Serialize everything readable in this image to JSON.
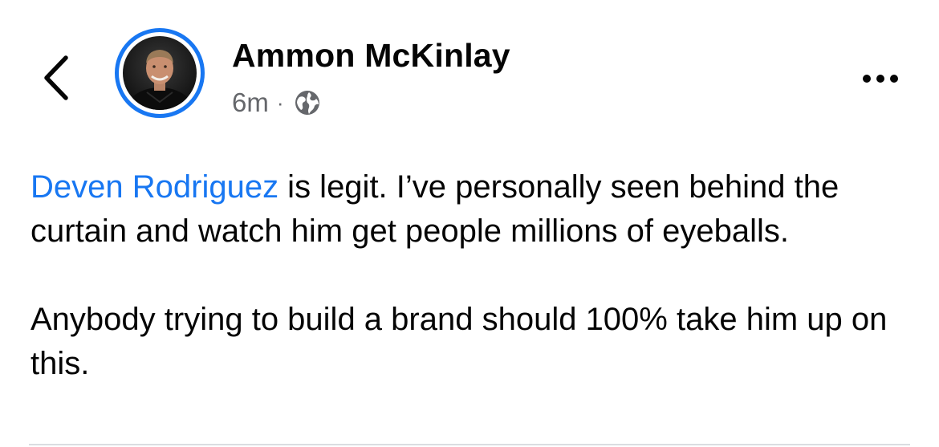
{
  "post": {
    "author": {
      "name": "Ammon McKinlay",
      "avatar_icon": "profile-photo"
    },
    "meta": {
      "time": "6m",
      "separator": "·",
      "audience_icon": "globe-icon"
    },
    "body": {
      "mention": "Deven Rodriguez",
      "paragraph1_rest": " is legit. I’ve personally seen behind the curtain and watch him get people millions of eyeballs.",
      "paragraph2": "Anybody trying to build a brand should 100% take him up on this."
    }
  },
  "icons": {
    "back": "chevron-left-icon",
    "more": "more-horizontal-icon"
  },
  "colors": {
    "accent": "#1877f2",
    "text": "#050505",
    "secondary_text": "#65676b",
    "divider": "#dadde1"
  }
}
